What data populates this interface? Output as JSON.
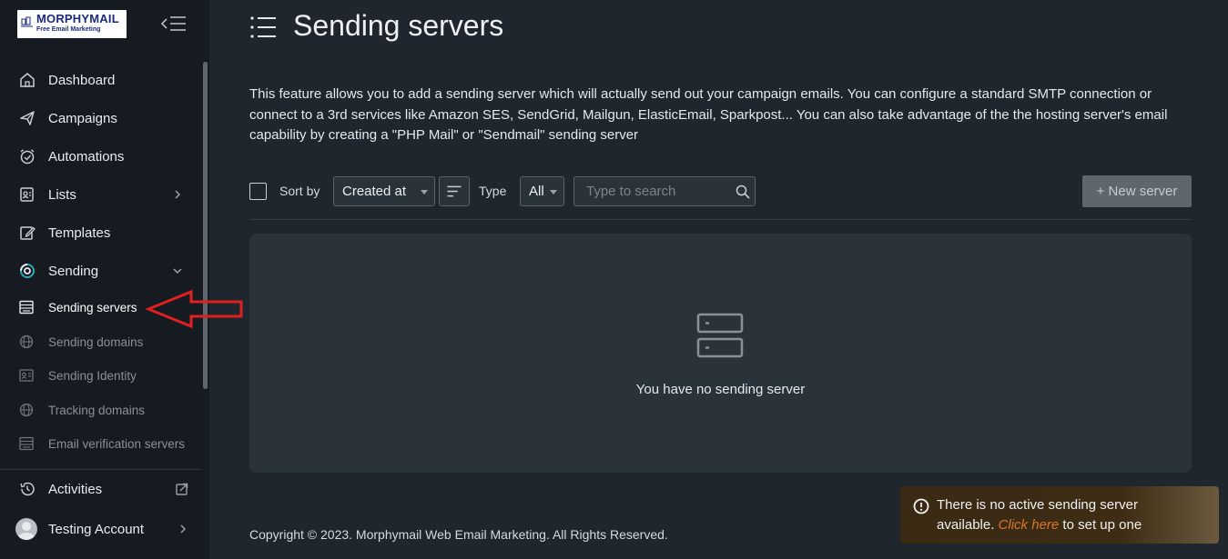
{
  "brand": {
    "name": "MORPHYMAIL",
    "tagline": "Free Email Marketing"
  },
  "sidebar": {
    "items": [
      {
        "label": "Dashboard",
        "icon": "home-icon"
      },
      {
        "label": "Campaigns",
        "icon": "send-icon"
      },
      {
        "label": "Automations",
        "icon": "alarm-icon"
      },
      {
        "label": "Lists",
        "icon": "contacts-icon"
      },
      {
        "label": "Templates",
        "icon": "edit-icon"
      },
      {
        "label": "Sending",
        "icon": "sync-icon"
      }
    ],
    "sub_items": [
      {
        "label": "Sending servers",
        "icon": "server-icon"
      },
      {
        "label": "Sending domains",
        "icon": "globe-icon"
      },
      {
        "label": "Sending Identity",
        "icon": "id-card-icon"
      },
      {
        "label": "Tracking domains",
        "icon": "globe-icon"
      },
      {
        "label": "Email verification servers",
        "icon": "server-icon"
      }
    ],
    "activities": "Activities",
    "account": "Testing Account"
  },
  "page": {
    "title": "Sending servers",
    "description": "This feature allows you to add a sending server which will actually send out your campaign emails. You can configure a standard SMTP connection or connect to a 3rd services like Amazon SES, SendGrid, Mailgun, ElasticEmail, Sparkpost... You can also take advantage of the the hosting server's email capability by creating a \"PHP Mail\" or \"Sendmail\" sending server"
  },
  "toolbar": {
    "sort_label": "Sort by",
    "sort_value": "Created at",
    "type_label": "Type",
    "type_value": "All",
    "search_placeholder": "Type to search",
    "new_server": "+ New server"
  },
  "empty_state": {
    "text": "You have no sending server"
  },
  "footer": "Copyright © 2023. Morphymail Web Email Marketing. All Rights Reserved.",
  "toast": {
    "line1": "There is no active sending server",
    "line2_before": "available.",
    "link": "Click here",
    "line2_after": "to set up one"
  },
  "colors": {
    "sidebar_bg": "#151b21",
    "main_bg": "#1f262e",
    "panel_bg": "#2a323a",
    "annotation_arrow": "#e02020",
    "toast_link": "#d9762b"
  }
}
